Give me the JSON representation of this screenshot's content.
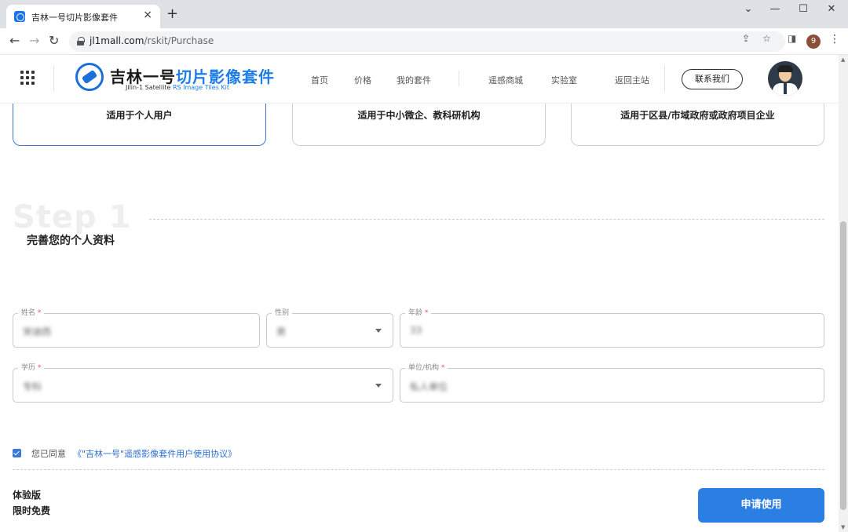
{
  "browser": {
    "tab_title": "吉林一号切片影像套件",
    "tab_close": "×",
    "new_tab": "+",
    "url_host": "jl1mall.com",
    "url_path": "/rskit/Purchase",
    "profile_initial": "9",
    "controls": {
      "chevron": "⌄",
      "minimize": "—",
      "maximize": "☐",
      "close": "✕"
    },
    "nav": {
      "back": "←",
      "forward": "→",
      "reload": "↻"
    }
  },
  "header": {
    "logo_cn_black": "吉林一号",
    "logo_cn_blue": "切片影像套件",
    "logo_en_black": "Jilin-1  Satellite ",
    "logo_en_blue": "RS Image Tiles Kit",
    "nav": [
      "首页",
      "价格",
      "我的套件",
      "遥感商城",
      "实验室",
      "返回主站"
    ],
    "contact": "联系我们"
  },
  "plans": [
    {
      "label": "适用于个人用户",
      "active": true
    },
    {
      "label": "适用于中小微企、教科研机构",
      "active": false
    },
    {
      "label": "适用于区县/市域政府或政府项目企业",
      "active": false
    }
  ],
  "step": {
    "ghost": "Step 1",
    "title": "完善您的个人资料"
  },
  "form": {
    "name_label": "姓名",
    "name_value": "宋迪西",
    "gender_label": "性别",
    "gender_value": "男",
    "age_label": "年龄",
    "age_value": "33",
    "education_label": "学历",
    "education_value": "专科",
    "org_label": "单位/机构",
    "org_value": "私人单位",
    "required_mark": "*"
  },
  "agreement": {
    "checked": true,
    "prefix": "您已同意",
    "link": "《\"吉林一号\"遥感影像套件用户使用协议》"
  },
  "footer": {
    "edition": "体验版",
    "price": "限时免费",
    "apply": "申请使用"
  },
  "colors": {
    "accent": "#2b7fe3",
    "brand_blue": "#1e7de6"
  }
}
